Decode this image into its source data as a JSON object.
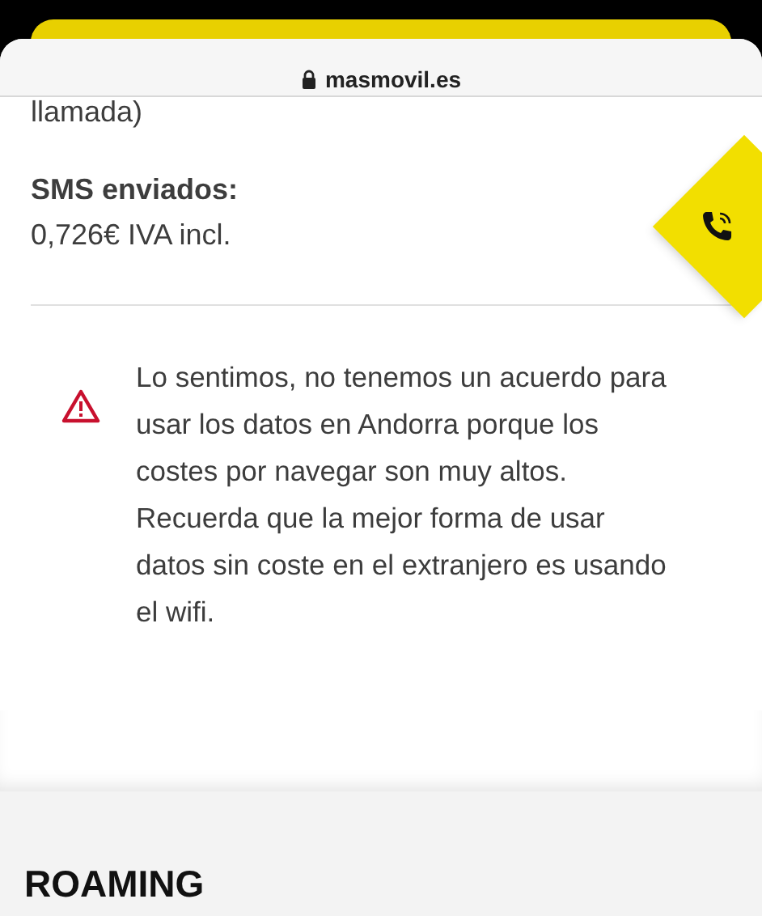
{
  "address_bar": {
    "url": "masmovil.es"
  },
  "rate_tail": "llamada)",
  "sms": {
    "label": "SMS enviados:",
    "value": "0,726€ IVA incl."
  },
  "notice": {
    "message": "Lo sentimos, no tenemos un acuerdo para usar los datos en Andorra porque los costes por navegar son muy altos. Recuerda que la mejor forma de usar datos sin coste en el extranjero es usando el wifi."
  },
  "section_heading": "ROAMING"
}
